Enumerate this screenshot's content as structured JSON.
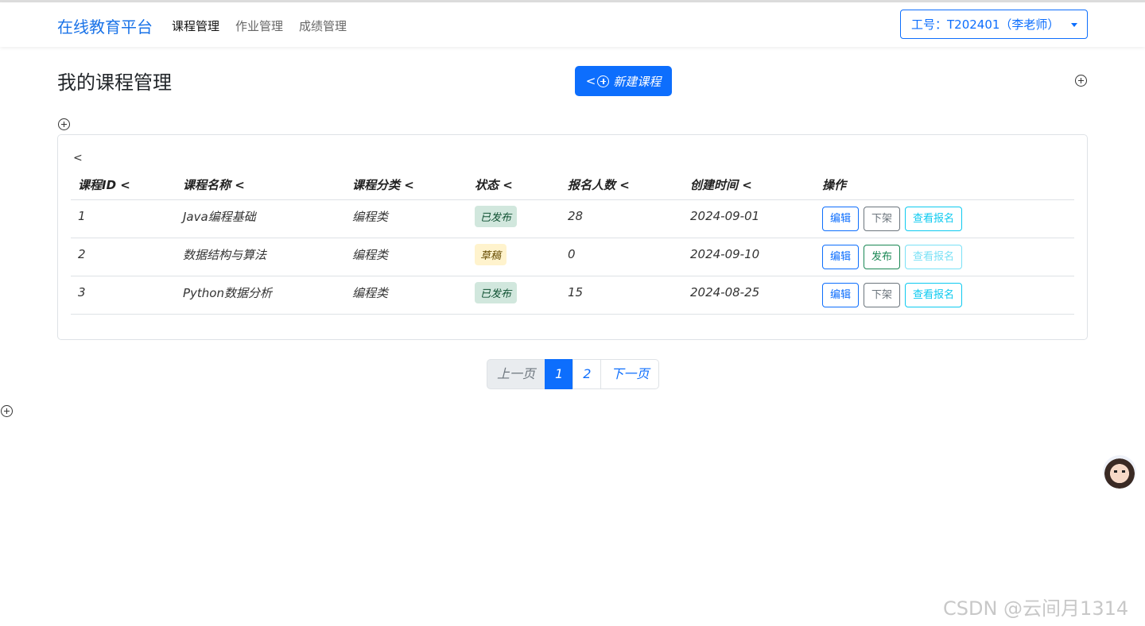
{
  "navbar": {
    "brand": "在线教育平台",
    "links": [
      "课程管理",
      "作业管理",
      "成绩管理"
    ],
    "user": "工号：T202401（李老师）"
  },
  "main": {
    "title": "我的课程管理",
    "new_button": "新建课程",
    "new_button_prefix": "<",
    "card_prefix": "<"
  },
  "table": {
    "headers": [
      "课程ID <",
      "课程名称 <",
      "课程分类 <",
      "状态 <",
      "报名人数 <",
      "创建时间 <",
      "操作"
    ],
    "rows": [
      {
        "id": "1",
        "name": "Java编程基础",
        "category": "编程类",
        "status": "已发布",
        "enrolled": "28",
        "created": "2024-09-01",
        "actions": [
          "编辑",
          "下架",
          "查看报名"
        ]
      },
      {
        "id": "2",
        "name": "数据结构与算法",
        "category": "编程类",
        "status": "草稿",
        "enrolled": "0",
        "created": "2024-09-10",
        "actions": [
          "编辑",
          "发布",
          "查看报名"
        ]
      },
      {
        "id": "3",
        "name": "Python数据分析",
        "category": "编程类",
        "status": "已发布",
        "enrolled": "15",
        "created": "2024-08-25",
        "actions": [
          "编辑",
          "下架",
          "查看报名"
        ]
      }
    ]
  },
  "pagination": {
    "prev": "上一页",
    "pages": [
      "1",
      "2"
    ],
    "current": "1",
    "next": "下一页"
  },
  "colors": {
    "primary": "#0d6efd",
    "brand": "#1a73e8",
    "published_bg": "#d1e7dd",
    "draft_bg": "#fff3cd"
  },
  "icons": [
    "circle-plus-icon",
    "caret-down-icon",
    "assistant-avatar-icon"
  ],
  "watermark": "CSDN @云间月1314"
}
